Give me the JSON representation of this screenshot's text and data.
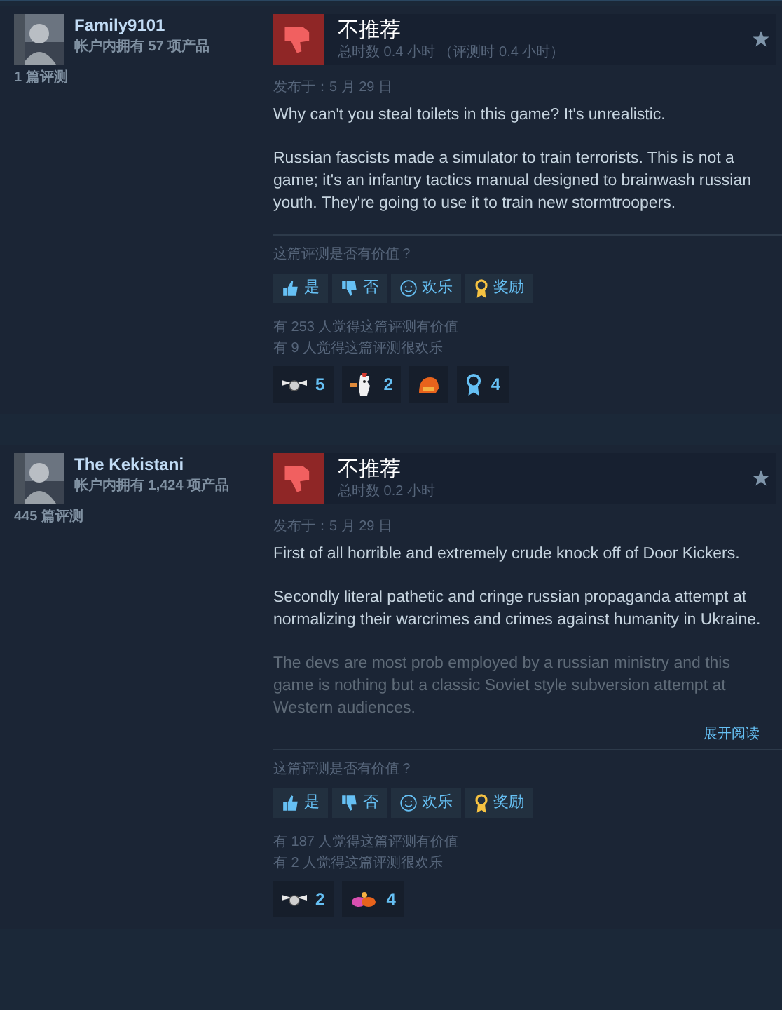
{
  "reviews": [
    {
      "author": {
        "name": "Family9101",
        "products": "帐户内拥有 57 项产品",
        "reviews": "1 篇评测"
      },
      "verdict": {
        "label": "不推荐",
        "recommended": false,
        "playtime": "总时数 0.4 小时 （评测时 0.4 小时）"
      },
      "posted": "发布于：5 月 29 日",
      "paragraphs": [
        "Why can't you steal toilets in this game? It's unrealistic.",
        "Russian fascists made a simulator to train terrorists. This is not a game; it's an infantry tactics manual designed to brainwash russian youth. They're going to use it to train new stormtroopers."
      ],
      "question": "这篇评测是否有价值？",
      "votes": [
        {
          "kind": "up",
          "label": "是"
        },
        {
          "kind": "down",
          "label": "否"
        },
        {
          "kind": "smile",
          "label": "欢乐"
        },
        {
          "kind": "award",
          "label": "奖励"
        }
      ],
      "stats": [
        "有 253 人觉得这篇评测有价值",
        "有 9 人觉得这篇评测很欢乐"
      ],
      "reactions": [
        {
          "kind": "wings",
          "count": "5"
        },
        {
          "kind": "chicken",
          "count": "2"
        },
        {
          "kind": "helmet"
        },
        {
          "kind": "ribbon",
          "count": "4"
        }
      ]
    },
    {
      "author": {
        "name": "The Kekistani",
        "products": "帐户内拥有 1,424 项产品",
        "reviews": "445 篇评测"
      },
      "verdict": {
        "label": "不推荐",
        "recommended": false,
        "playtime": "总时数 0.2 小时"
      },
      "posted": "发布于：5 月 29 日",
      "paragraphs": [
        "First of all horrible and extremely crude knock off of Door Kickers.",
        "Secondly literal pathetic and cringe russian propaganda attempt at normalizing their warcrimes and crimes against humanity in Ukraine.",
        "The devs are most prob employed by a russian ministry and this game is nothing but a classic Soviet style subversion attempt at Western audiences."
      ],
      "expand": "展开阅读",
      "question": "这篇评测是否有价值？",
      "votes": [
        {
          "kind": "up",
          "label": "是"
        },
        {
          "kind": "down",
          "label": "否"
        },
        {
          "kind": "smile",
          "label": "欢乐"
        },
        {
          "kind": "award",
          "label": "奖励"
        }
      ],
      "stats": [
        "有 187 人觉得这篇评测有价值",
        "有 2 人觉得这篇评测很欢乐"
      ],
      "reactions": [
        {
          "kind": "wings",
          "count": "2"
        },
        {
          "kind": "cloud",
          "count": "4"
        }
      ]
    }
  ]
}
